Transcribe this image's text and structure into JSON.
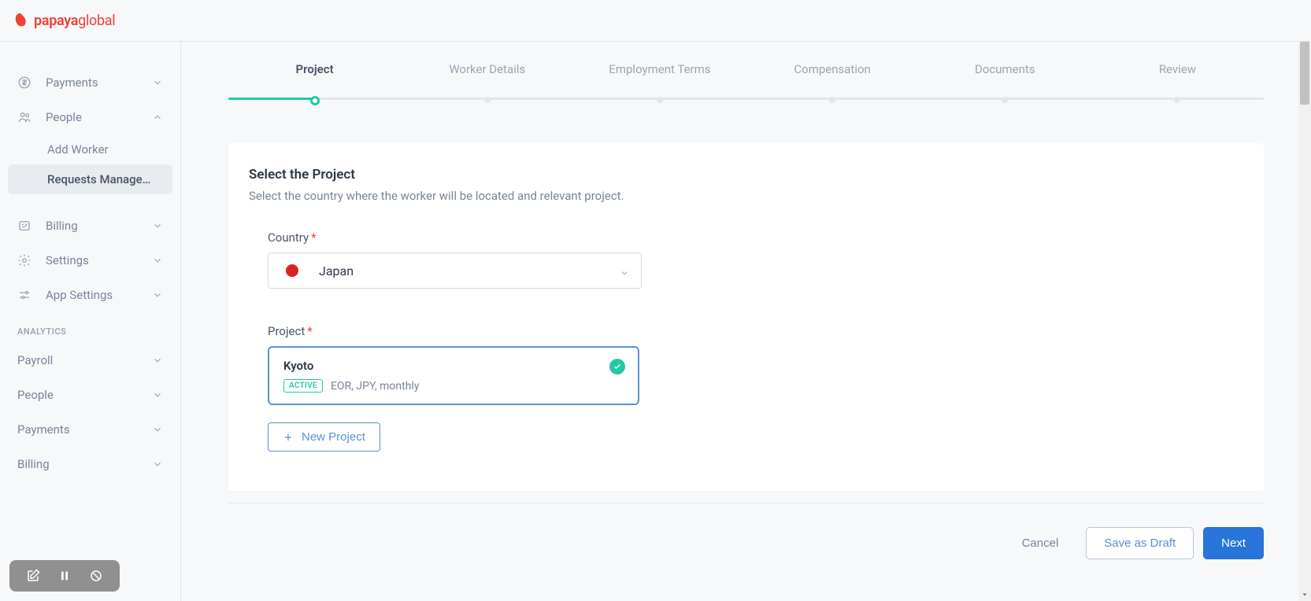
{
  "brand": {
    "name_bold": "papaya",
    "name_light": "global"
  },
  "sidebar": {
    "items": [
      {
        "label": "Payments"
      },
      {
        "label": "People"
      },
      {
        "label": "Billing"
      },
      {
        "label": "Settings"
      },
      {
        "label": "App Settings"
      }
    ],
    "people_sub": [
      {
        "label": "Add Worker"
      },
      {
        "label": "Requests Managem…"
      }
    ],
    "analytics_label": "ANALYTICS",
    "analytics": [
      {
        "label": "Payroll"
      },
      {
        "label": "People"
      },
      {
        "label": "Payments"
      },
      {
        "label": "Billing"
      }
    ]
  },
  "stepper": {
    "steps": [
      "Project",
      "Worker Details",
      "Employment Terms",
      "Compensation",
      "Documents",
      "Review"
    ]
  },
  "card": {
    "title": "Select the Project",
    "subtitle": "Select the country where the worker will be located and relevant project.",
    "country_label": "Country",
    "country_value": "Japan",
    "project_label": "Project",
    "project": {
      "name": "Kyoto",
      "badge": "ACTIVE",
      "details": "EOR, JPY, monthly"
    },
    "new_project": "New Project"
  },
  "footer": {
    "cancel": "Cancel",
    "save_draft": "Save as Draft",
    "next": "Next"
  }
}
